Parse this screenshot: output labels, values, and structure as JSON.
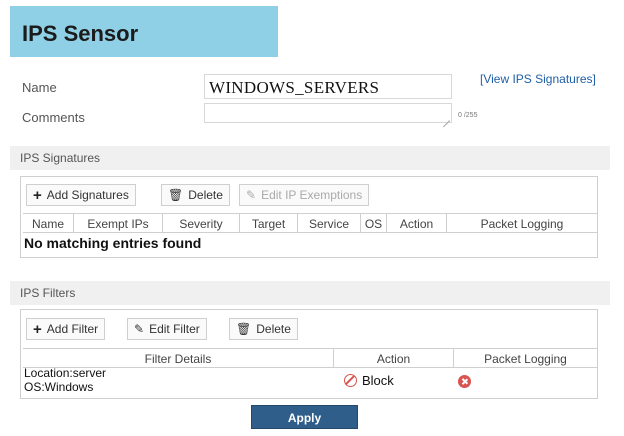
{
  "header": {
    "title": "IPS Sensor"
  },
  "form": {
    "name_label": "Name",
    "name_value": "WINDOWS_SERVERS",
    "view_signatures_link": "[View IPS Signatures]",
    "comments_label": "Comments",
    "comments_value": "",
    "comments_counter": "0 /255"
  },
  "signatures": {
    "section_title": "IPS Signatures",
    "toolbar": {
      "add_label": "Add Signatures",
      "delete_label": "Delete",
      "edit_exemptions_label": "Edit IP Exemptions"
    },
    "columns": [
      "Name",
      "Exempt IPs",
      "Severity",
      "Target",
      "Service",
      "OS",
      "Action",
      "Packet Logging"
    ],
    "empty_message": "No matching entries found"
  },
  "filters": {
    "section_title": "IPS Filters",
    "toolbar": {
      "add_label": "Add Filter",
      "edit_label": "Edit Filter",
      "delete_label": "Delete"
    },
    "columns": [
      "Filter Details",
      "Action",
      "Packet Logging"
    ],
    "rows": [
      {
        "details_line1": "Location:server",
        "details_line2": "OS:Windows",
        "action": "Block",
        "action_icon": "block-icon",
        "packet_logging_icon": "disabled-icon"
      }
    ]
  },
  "footer": {
    "apply_label": "Apply"
  },
  "colors": {
    "banner": "#8fd0e6",
    "apply": "#2f5e8a",
    "danger": "#d9534f",
    "link": "#1f5fa6"
  }
}
